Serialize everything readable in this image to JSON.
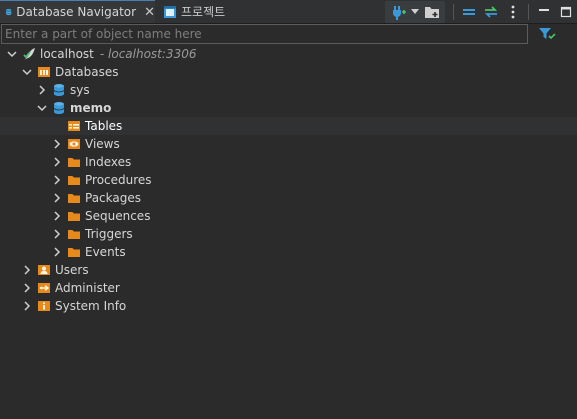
{
  "tabs": [
    {
      "label": "Database Navigator",
      "close": "✕",
      "active": true
    },
    {
      "label": "프로젝트",
      "active": false
    }
  ],
  "filter": {
    "placeholder": "Enter a part of object name here"
  },
  "tree": {
    "connection": {
      "label": "localhost",
      "sublabel": "- localhost:3306"
    },
    "databases": {
      "label": "Databases"
    },
    "sys": {
      "label": "sys"
    },
    "memo": {
      "label": "memo"
    },
    "memo_children": [
      "Tables",
      "Views",
      "Indexes",
      "Procedures",
      "Packages",
      "Sequences",
      "Triggers",
      "Events"
    ],
    "users": {
      "label": "Users"
    },
    "administer": {
      "label": "Administer"
    },
    "system_info": {
      "label": "System Info"
    }
  },
  "colors": {
    "background": "#2b2b2b",
    "folder": "#e8891c",
    "database": "#3a9ad9",
    "text": "#d6d6d6",
    "sublabel": "#9a9a9a"
  }
}
